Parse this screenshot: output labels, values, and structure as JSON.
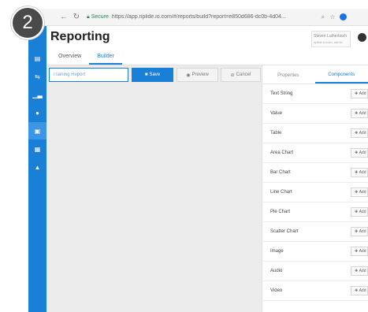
{
  "step_badge": "2",
  "browser": {
    "secure_label": "Secure",
    "url": "https://app.riplide.io.com/#/reports/build?report=e850d686-dc0b-4d04..."
  },
  "page": {
    "title": "Reporting",
    "user_name": "Steven Lutherbach",
    "user_sub": "riplide.io.com, admin"
  },
  "tabs": [
    {
      "label": "Overview"
    },
    {
      "label": "Builder"
    }
  ],
  "toolbar": {
    "report_name_value": "Training Report",
    "save_label": "Save",
    "preview_label": "Preview",
    "cancel_label": "Cancel"
  },
  "panel_tabs": [
    {
      "label": "Properties"
    },
    {
      "label": "Components"
    }
  ],
  "components": [
    {
      "label": "Text String",
      "add_label": "Add"
    },
    {
      "label": "Value",
      "add_label": "Add"
    },
    {
      "label": "Table",
      "add_label": "Add"
    },
    {
      "label": "Area Chart",
      "add_label": "Add"
    },
    {
      "label": "Bar Chart",
      "add_label": "Add"
    },
    {
      "label": "Line Chart",
      "add_label": "Add"
    },
    {
      "label": "Pie Chart",
      "add_label": "Add"
    },
    {
      "label": "Scatter Chart",
      "add_label": "Add"
    },
    {
      "label": "Image",
      "add_label": "Add"
    },
    {
      "label": "Audio",
      "add_label": "Add"
    },
    {
      "label": "Video",
      "add_label": "Add"
    }
  ],
  "colors": {
    "accent": "#1a7fd6",
    "sidebar": "#1a7fd6"
  }
}
